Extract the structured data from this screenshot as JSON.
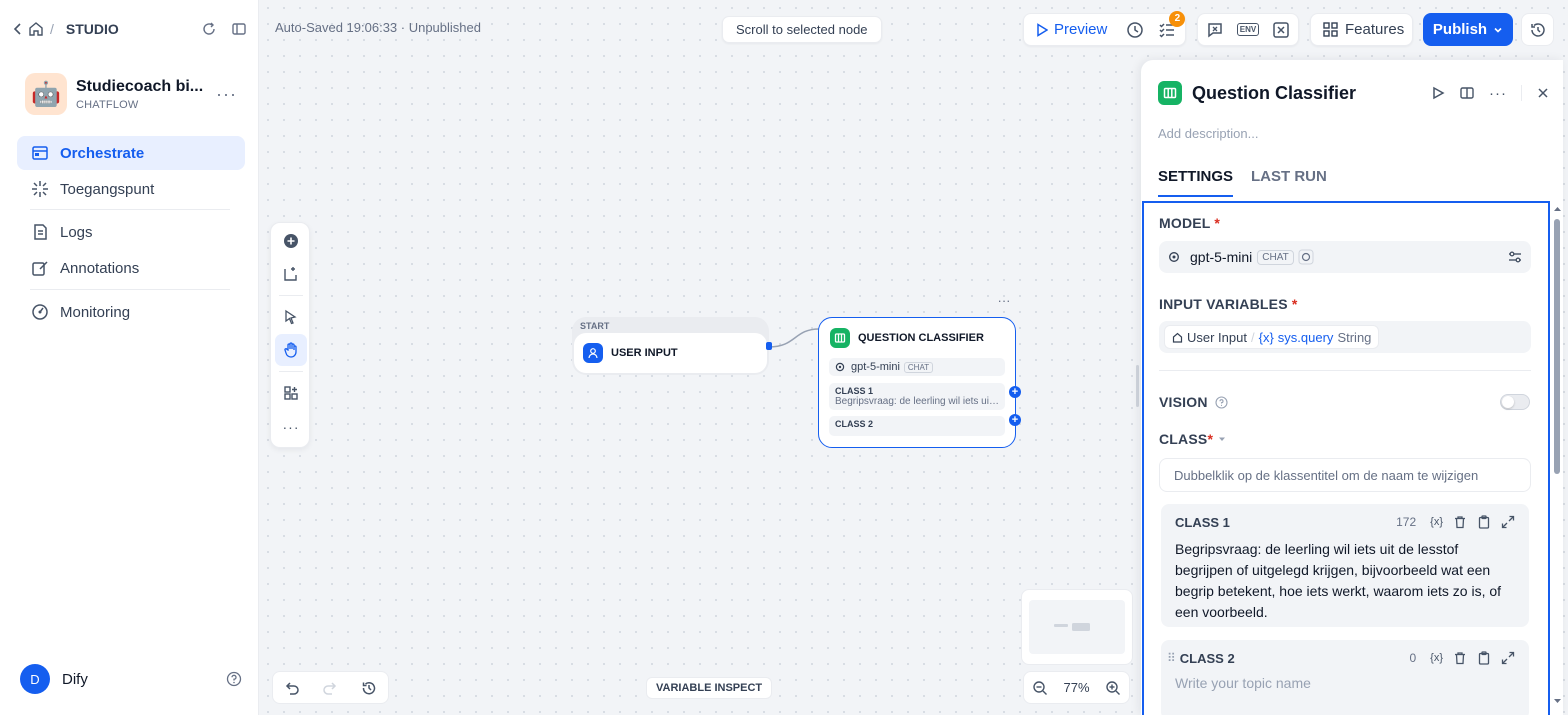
{
  "sidebar": {
    "breadcrumb": "STUDIO",
    "app_name": "Studiecoach bi...",
    "app_type": "CHATFLOW",
    "nav": [
      {
        "label": "Orchestrate"
      },
      {
        "label": "Toegangspunt"
      },
      {
        "label": "Logs"
      },
      {
        "label": "Annotations"
      },
      {
        "label": "Monitoring"
      }
    ],
    "user_initial": "D",
    "user_name": "Dify"
  },
  "header": {
    "autosave": "Auto-Saved 19:06:33 · Unpublished",
    "scroll_to_node": "Scroll to selected node",
    "preview": "Preview",
    "checklist_count": "2",
    "env_label": "ENV",
    "features": "Features",
    "publish": "Publish"
  },
  "canvas": {
    "start_node": {
      "label": "START",
      "title": "USER INPUT"
    },
    "classifier_node": {
      "title": "QUESTION CLASSIFIER",
      "model": "gpt-5-mini",
      "model_tag": "CHAT",
      "class1_title": "CLASS 1",
      "class1_desc": "Begripsvraag: de leerling wil iets uit de lesstof begrijpen of uitgelegd krijgen",
      "class2_title": "CLASS 2"
    },
    "variable_inspect": "VARIABLE INSPECT",
    "zoom_level": "77%"
  },
  "panel": {
    "title": "Question Classifier",
    "description_placeholder": "Add description...",
    "tabs": [
      {
        "label": "SETTINGS"
      },
      {
        "label": "LAST RUN"
      }
    ],
    "model_label": "MODEL",
    "model_name": "gpt-5-mini",
    "model_tag": "CHAT",
    "input_vars_label": "INPUT VARIABLES",
    "var_source": "User Input",
    "var_name": "sys.query",
    "var_type": "String",
    "vision_label": "VISION",
    "class_label": "CLASS",
    "class_hint": "Dubbelklik op de klassentitel om de naam te wijzigen",
    "classes": [
      {
        "title": "CLASS 1",
        "count": "172",
        "text": "Begripsvraag: de leerling wil iets uit de lesstof begrijpen of uitgelegd krijgen, bijvoorbeeld wat een begrip betekent, hoe iets werkt, waarom iets zo is, of een voorbeeld."
      },
      {
        "title": "CLASS 2",
        "count": "0",
        "placeholder": "Write your topic name"
      }
    ],
    "var_icon_label": "{x}"
  },
  "colors": {
    "accent": "#155eef",
    "classifier": "#16b364",
    "badge": "#f79009"
  }
}
